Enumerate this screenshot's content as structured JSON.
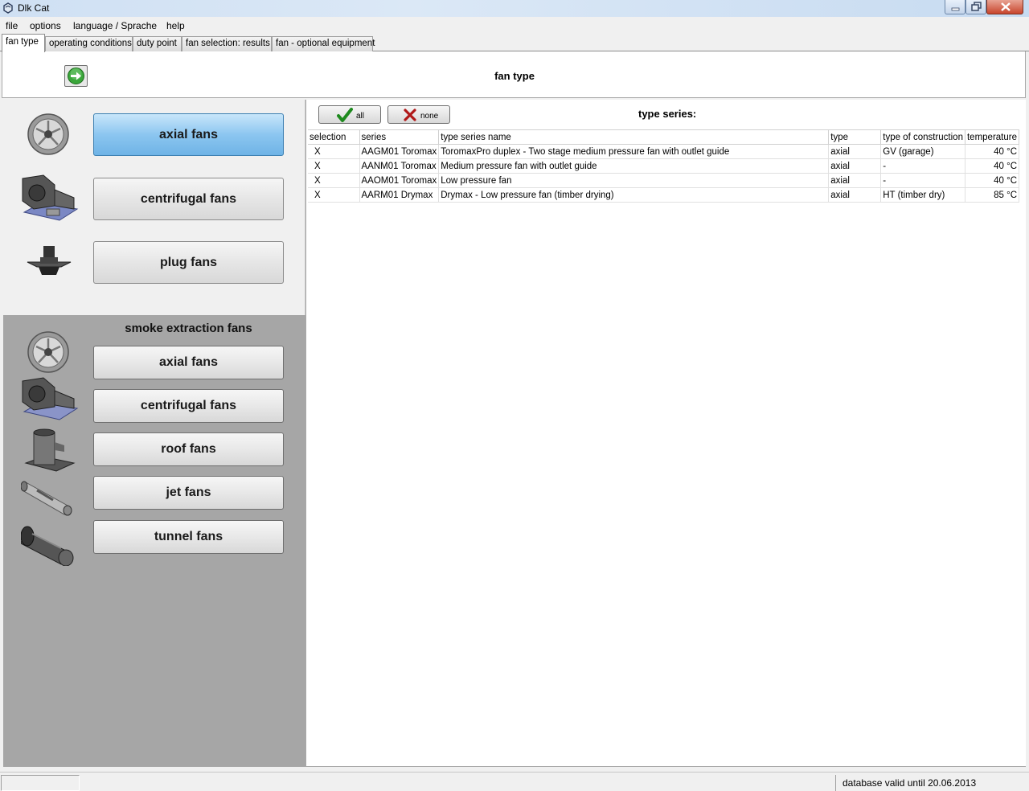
{
  "window": {
    "title": "Dlk Cat"
  },
  "menu": [
    "file",
    "options",
    "language / Sprache",
    "help"
  ],
  "tabs": [
    "fan type",
    "operating conditions",
    "duty point",
    "fan selection: results",
    "fan - optional equipment"
  ],
  "header": {
    "title": "fan type"
  },
  "fan_types": {
    "axial": "axial fans",
    "centrifugal": "centrifugal fans",
    "plug": "plug fans"
  },
  "smoke": {
    "title": "smoke extraction fans",
    "axial": "axial fans",
    "centrifugal": "centrifugal fans",
    "roof": "roof fans",
    "jet": "jet fans",
    "tunnel": "tunnel fans"
  },
  "toolbar": {
    "all": "all",
    "none": "none",
    "type_series_label": "type series:"
  },
  "table": {
    "columns": [
      "selection",
      "series",
      "type series name",
      "type",
      "type of construction",
      "temperature"
    ],
    "rows": [
      [
        "X",
        "AAGM01 Toromax",
        "ToromaxPro duplex - Two stage medium pressure fan with outlet guide",
        "axial",
        "GV (garage)",
        "40 °C"
      ],
      [
        "X",
        "AANM01 Toromax",
        "Medium pressure fan with outlet guide",
        "axial",
        "-",
        "40 °C"
      ],
      [
        "X",
        "AAOM01 Toromax",
        "Low pressure fan",
        "axial",
        "-",
        "40 °C"
      ],
      [
        "X",
        "AARM01 Drymax",
        "Drymax - Low pressure fan (timber drying)",
        "axial",
        "HT (timber dry)",
        "85 °C"
      ]
    ]
  },
  "status": {
    "db_valid": "database valid until 20.06.2013"
  }
}
